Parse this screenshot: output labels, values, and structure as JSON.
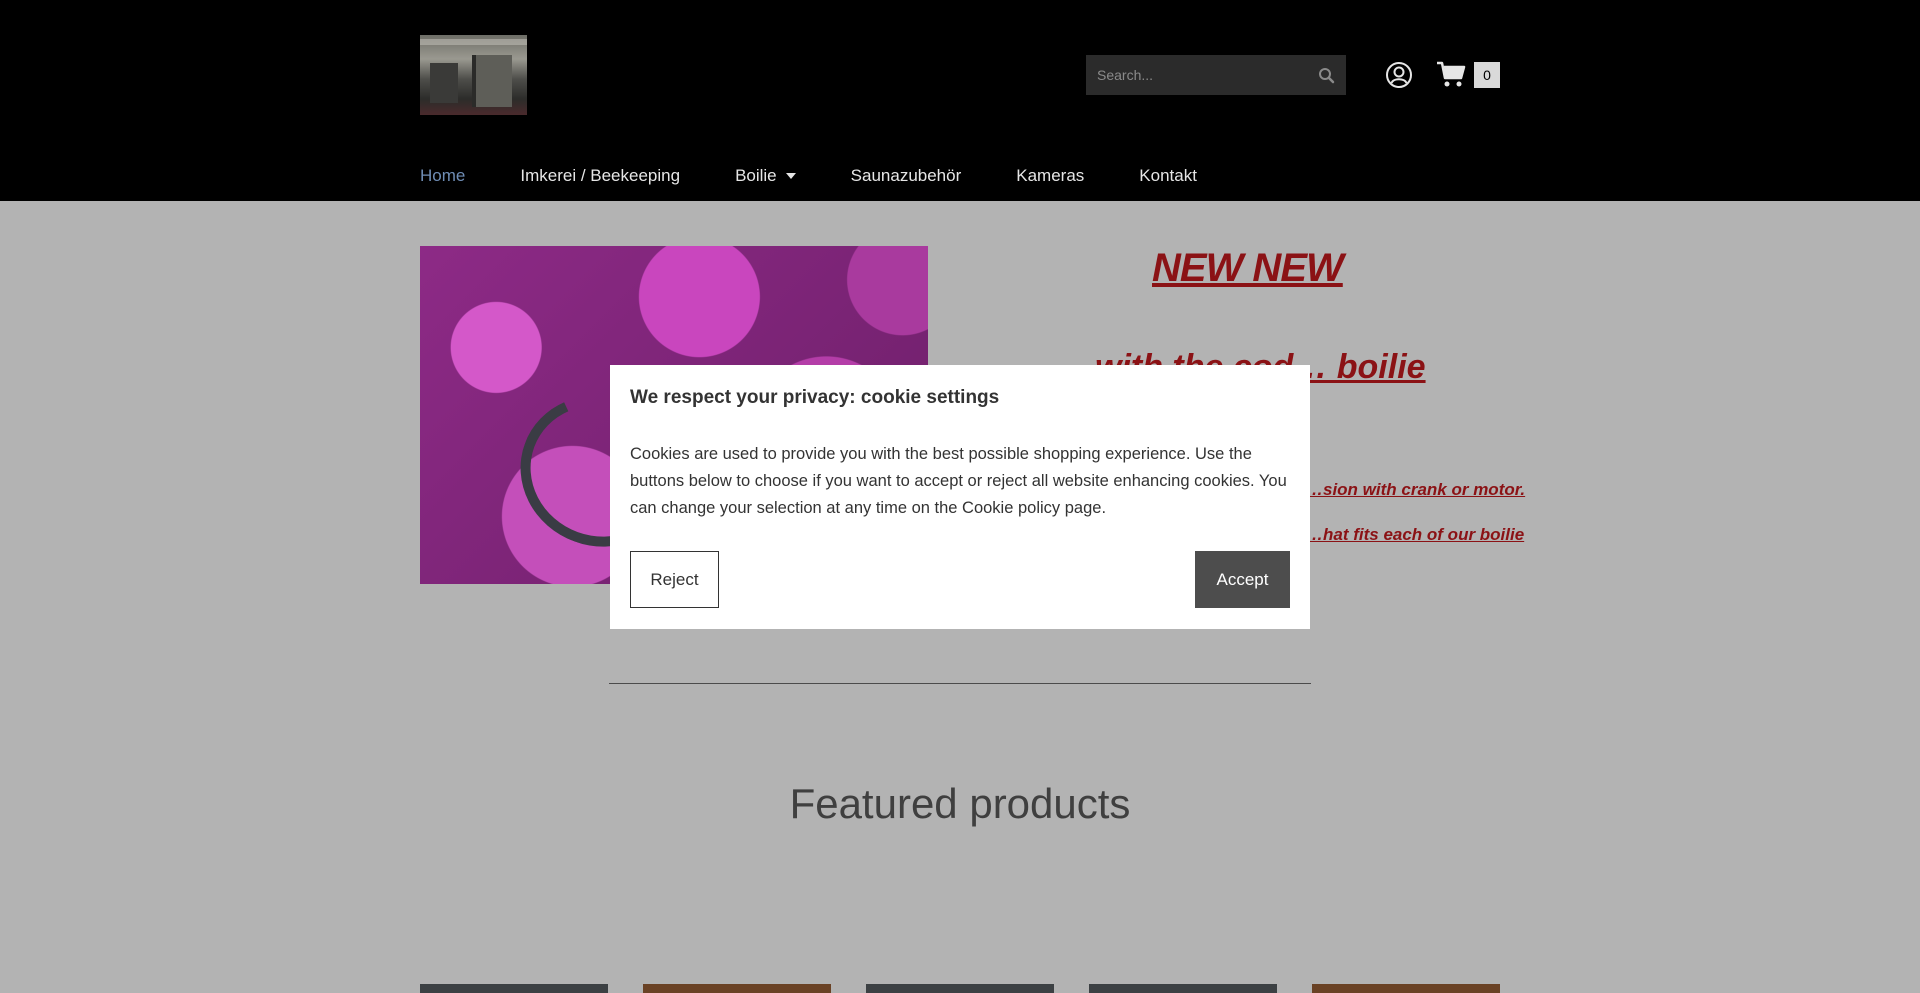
{
  "header": {
    "search": {
      "placeholder": "Search..."
    },
    "cart": {
      "count": "0"
    },
    "icons": {
      "search": "search-icon",
      "account": "user-circle-icon",
      "cart": "shopping-cart-icon"
    }
  },
  "nav": {
    "items": [
      {
        "label": "Home",
        "active": true
      },
      {
        "label": "Imkerei / Beekeeping"
      },
      {
        "label": "Boilie",
        "has_dropdown": true
      },
      {
        "label": "Saunazubehör"
      },
      {
        "label": "Kameras"
      },
      {
        "label": "Kontakt"
      }
    ]
  },
  "hero": {
    "headline": "NEW NEW",
    "line2": "with the cod… boilie",
    "line3": "…sion with crank or motor.",
    "line4": "…hat fits each of our boilie",
    "text_color": "#8b1215"
  },
  "featured": {
    "title": "Featured products"
  },
  "cookie_modal": {
    "title": "We respect your privacy: cookie settings",
    "body": "Cookies are used to provide you with the best possible shopping experience. Use the buttons below to choose if you want to accept or reject all website enhancing cookies. You can change your selection at any time on the Cookie policy page.",
    "reject_label": "Reject",
    "accept_label": "Accept"
  },
  "colors": {
    "header_bg": "#000000",
    "page_bg": "#b3b3b3",
    "nav_active": "#6f8db5",
    "accept_bg": "#4d4d4d"
  }
}
